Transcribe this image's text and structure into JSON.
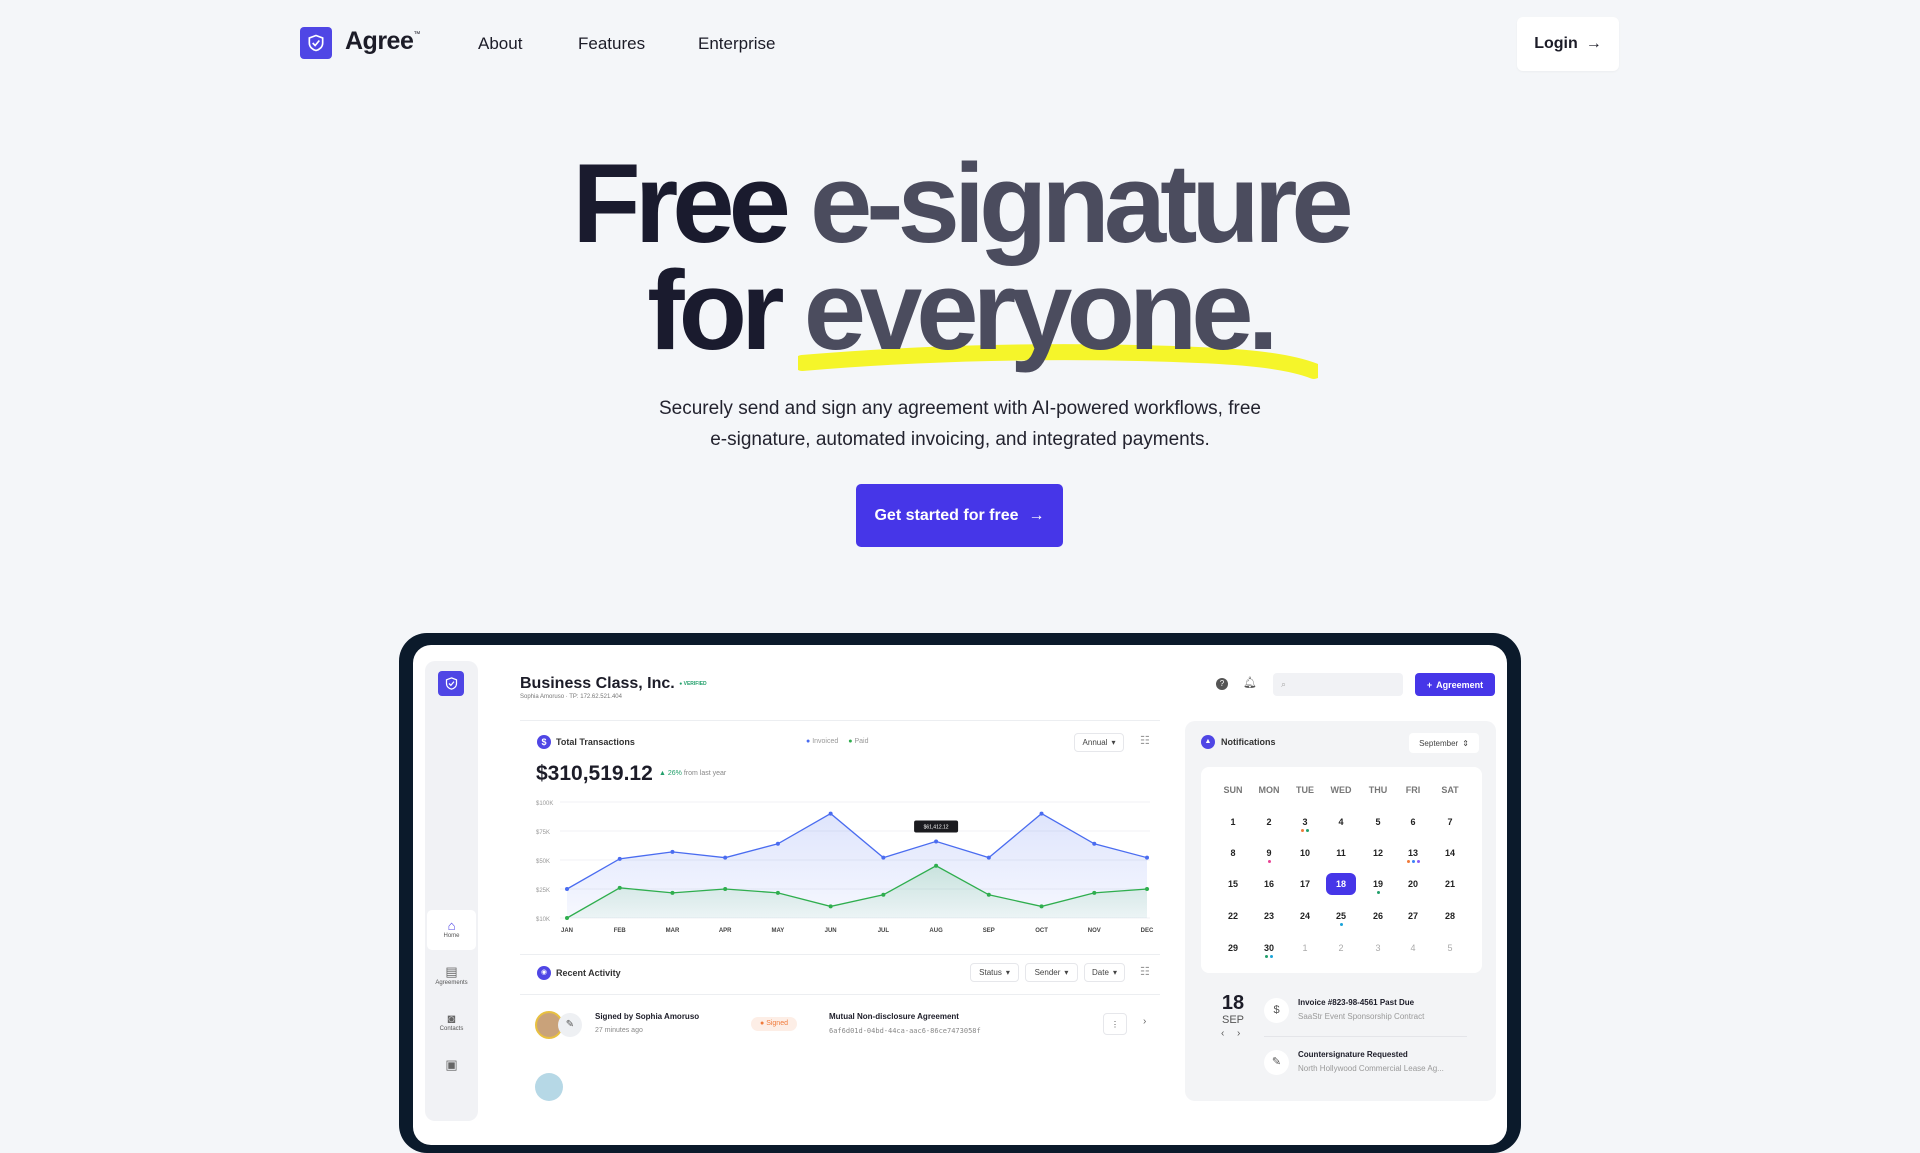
{
  "nav": {
    "brand": "Agree",
    "trademark": "™",
    "links": [
      "About",
      "Features",
      "Enterprise"
    ],
    "login_label": "Login",
    "accent": "#4f46e5"
  },
  "hero": {
    "line1_a": "Free",
    "line1_b": "e-signature",
    "line2_a": "for",
    "line2_b": "everyone",
    "line2_c": ".",
    "highlight_color": "#f5f52a",
    "subtitle_1": "Securely send and sign any agreement with AI-powered workflows, free",
    "subtitle_2": "e-signature, automated invoicing, and integrated payments.",
    "cta_label": "Get started for free"
  },
  "app": {
    "company": "Business Class, Inc.",
    "verified": "VERIFIED",
    "meta": "Sophia Amoruso · TP: 172.62.521.404",
    "new_button": "Agreement",
    "sidebar": [
      {
        "label": "Home",
        "icon": "home-icon"
      },
      {
        "label": "Agreements",
        "icon": "documents-icon"
      },
      {
        "label": "Contacts",
        "icon": "contact-icon"
      },
      {
        "label": "",
        "icon": "gallery-icon"
      }
    ],
    "transactions": {
      "title": "Total Transactions",
      "total": "$310,519.12",
      "change": "26%",
      "change_note": "from last year",
      "period": "Annual",
      "legend": [
        "Invoiced",
        "Paid"
      ],
      "tooltip": "$61,412.12"
    },
    "activity": {
      "title": "Recent Activity",
      "filters": [
        "Status",
        "Sender",
        "Date"
      ],
      "rows": [
        {
          "title": "Signed by Sophia Amoruso",
          "time": "27 minutes ago",
          "status": "Signed",
          "agreement": "Mutual Non-disclosure Agreement",
          "hash": "6af6d01d-04bd-44ca-aac6-86ce7473058f"
        }
      ]
    },
    "notifications": {
      "title": "Notifications",
      "month": "September",
      "weekdays": [
        "SUN",
        "MON",
        "TUE",
        "WED",
        "THU",
        "FRI",
        "SAT"
      ],
      "days": [
        [
          "1",
          "2",
          "3",
          "4",
          "5",
          "6",
          "7"
        ],
        [
          "8",
          "9",
          "10",
          "11",
          "12",
          "13",
          "14"
        ],
        [
          "15",
          "16",
          "17",
          "18",
          "19",
          "20",
          "21"
        ],
        [
          "22",
          "23",
          "24",
          "25",
          "26",
          "27",
          "28"
        ],
        [
          "29",
          "30",
          "1",
          "2",
          "3",
          "4",
          "5"
        ]
      ],
      "selected_day": "18",
      "day_dots": {
        "3": [
          "#f07a3a",
          "#22a06b"
        ],
        "9": [
          "#e84393"
        ],
        "13": [
          "#f07a3a",
          "#3b82f6",
          "#8b5cf6"
        ],
        "19": [
          "#22a06b"
        ],
        "25": [
          "#1aa3d9"
        ],
        "30": [
          "#22a06b",
          "#1aa3d9"
        ]
      },
      "date_day": "18",
      "date_month": "SEP",
      "items": [
        {
          "title": "Invoice #823-98-4561 Past Due",
          "subtitle": "SaaStr Event Sponsorship Contract",
          "icon": "dollar-icon"
        },
        {
          "title": "Countersignature Requested",
          "subtitle": "North Hollywood Commercial Lease Ag...",
          "icon": "signature-icon"
        }
      ]
    }
  },
  "chart_data": {
    "type": "line",
    "categories": [
      "JAN",
      "FEB",
      "MAR",
      "APR",
      "MAY",
      "JUN",
      "JUL",
      "AUG",
      "SEP",
      "OCT",
      "NOV",
      "DEC"
    ],
    "y_ticks": [
      "$100K",
      "$75K",
      "$50K",
      "$25K",
      "$10K"
    ],
    "y_tick_values": [
      100000,
      75000,
      50000,
      25000,
      10000
    ],
    "series": [
      {
        "name": "Invoiced",
        "color": "#4a6cf0",
        "values": [
          25000,
          51000,
          57000,
          52000,
          64000,
          90000,
          52000,
          66000,
          52000,
          90000,
          64000,
          52000
        ]
      },
      {
        "name": "Paid",
        "color": "#2fae4e",
        "values": [
          10000,
          26000,
          23000,
          25000,
          23000,
          16000,
          22000,
          45000,
          22000,
          16000,
          23000,
          25000
        ]
      }
    ],
    "grid": true
  }
}
